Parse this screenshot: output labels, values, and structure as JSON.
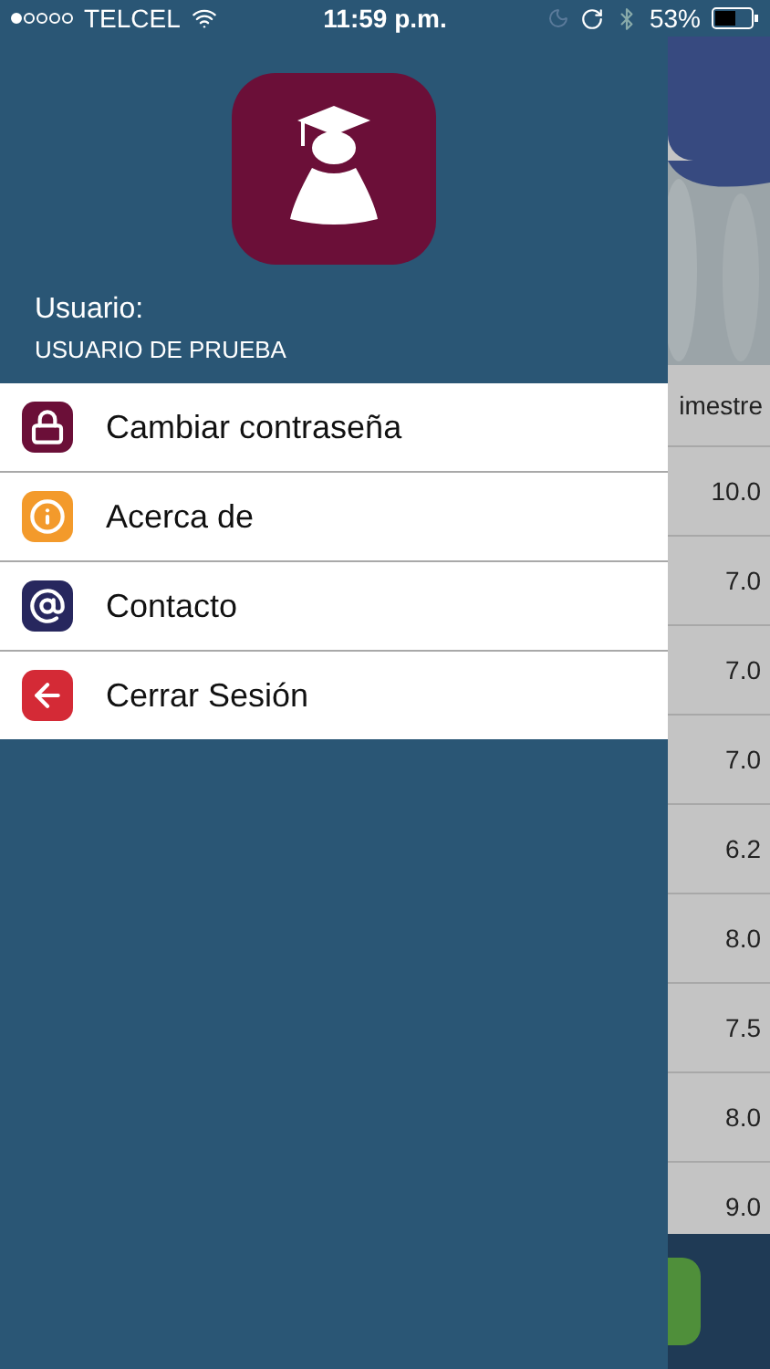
{
  "status_bar": {
    "carrier": "TELCEL",
    "time": "11:59 p.m.",
    "battery": "53%"
  },
  "drawer": {
    "user_label": "Usuario:",
    "user_name": "USUARIO DE PRUEBA",
    "menu": [
      {
        "label": "Cambiar contraseña",
        "kind": "lock",
        "color": "#6b0f38"
      },
      {
        "label": "Acerca de",
        "kind": "info",
        "color": "#f39a2b"
      },
      {
        "label": "Contacto",
        "kind": "at",
        "color": "#27275e"
      },
      {
        "label": "Cerrar Sesión",
        "kind": "logout",
        "color": "#d42a36"
      }
    ]
  },
  "background": {
    "column_header": "imestre",
    "grades": [
      "10.0",
      "7.0",
      "7.0",
      "7.0",
      "6.2",
      "8.0",
      "7.5",
      "8.0",
      "9.0"
    ]
  }
}
